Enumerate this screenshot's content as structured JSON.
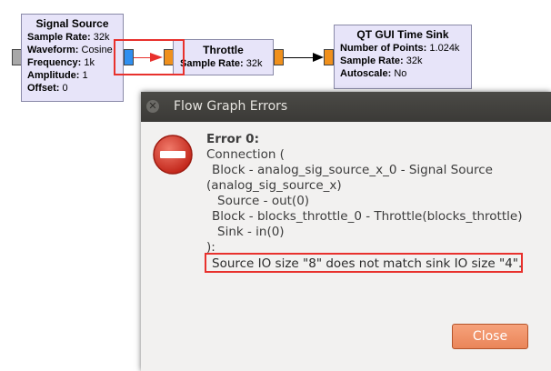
{
  "flowgraph": {
    "signal_source": {
      "title": "Signal Source",
      "params": [
        {
          "key": "Sample Rate:",
          "value": "32k"
        },
        {
          "key": "Waveform:",
          "value": "Cosine"
        },
        {
          "key": "Frequency:",
          "value": "1k"
        },
        {
          "key": "Amplitude:",
          "value": "1"
        },
        {
          "key": "Offset:",
          "value": "0"
        }
      ]
    },
    "throttle": {
      "title": "Throttle",
      "params": [
        {
          "key": "Sample Rate:",
          "value": "32k"
        }
      ]
    },
    "time_sink": {
      "title": "QT GUI Time Sink",
      "params": [
        {
          "key": "Number of Points:",
          "value": "1.024k"
        },
        {
          "key": "Sample Rate:",
          "value": "32k"
        },
        {
          "key": "Autoscale:",
          "value": "No"
        }
      ]
    },
    "colors": {
      "block_bg": "#e7e4f9",
      "port_complex": "#2f8ff0",
      "port_float": "#f0901c",
      "bad_connection": "#e8312d",
      "highlight": "#e8312d"
    }
  },
  "dialog": {
    "title": "Flow Graph Errors",
    "icon": "error-stop-icon",
    "error_title": "Error 0:",
    "lines": [
      "Connection (",
      " Block - analog_sig_source_x_0 - Signal Source",
      "(analog_sig_source_x)",
      "  Source - out(0)",
      " Block - blocks_throttle_0 - Throttle(blocks_throttle)",
      "  Sink - in(0)",
      "):"
    ],
    "error_message": "Source IO size \"8\" does not match sink IO size \"4\".",
    "close_label": "Close",
    "close_button_color": "#ea8559"
  }
}
